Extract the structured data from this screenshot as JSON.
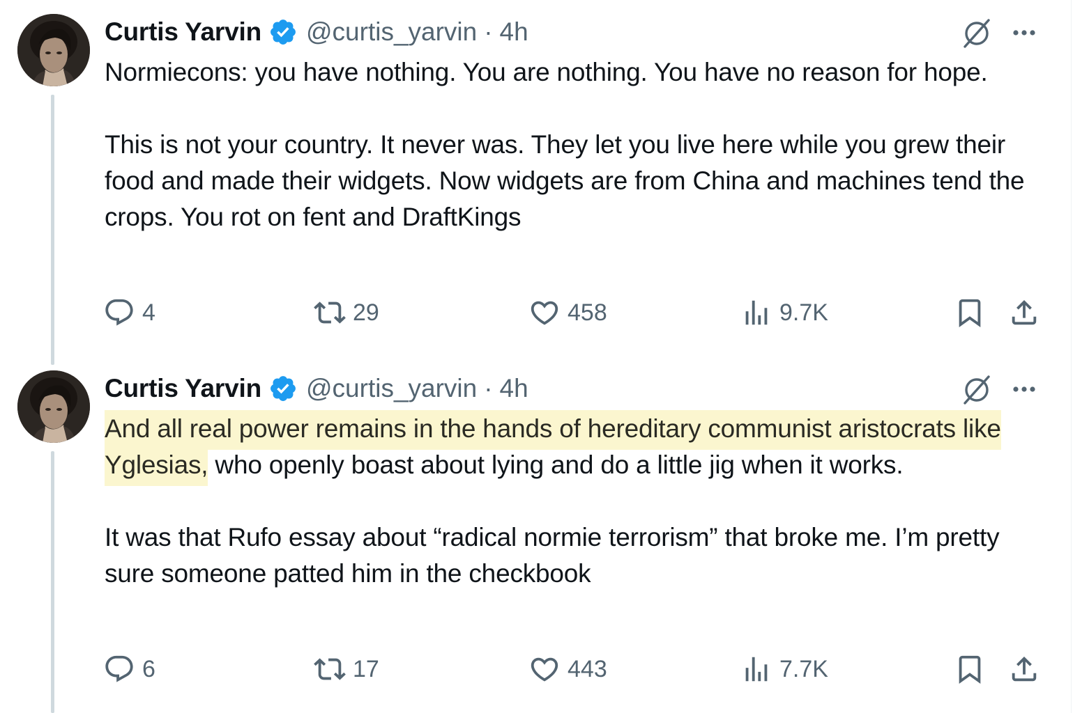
{
  "tweets": [
    {
      "author": {
        "name": "Curtis Yarvin",
        "handle": "@curtis_yarvin",
        "time": "4h",
        "separator": "·"
      },
      "text": {
        "p1": "Normiecons: you have nothing. You are nothing. You have no reason for hope.",
        "p2": "This is not your country. It never was. They let you live here while you grew their food and made their widgets. Now widgets are from China and machines tend the crops. You rot on fent and DraftKings"
      },
      "stats": {
        "replies": "4",
        "reposts": "29",
        "likes": "458",
        "views": "9.7K"
      }
    },
    {
      "author": {
        "name": "Curtis Yarvin",
        "handle": "@curtis_yarvin",
        "time": "4h",
        "separator": "·"
      },
      "text": {
        "highlighted": "And all real power remains in the hands of hereditary communist aristocrats like Yglesias,",
        "rest": " who openly boast about lying and do a little jig when it works.",
        "p2": "It was that Rufo essay about “radical normie terrorism” that broke me. I’m pretty sure someone patted him in the checkbook"
      },
      "stats": {
        "replies": "6",
        "reposts": "17",
        "likes": "443",
        "views": "7.7K"
      }
    }
  ],
  "icons": {
    "verified": "verified-badge-icon",
    "grok": "grok-icon",
    "more": "more-icon",
    "reply": "reply-icon",
    "repost": "repost-icon",
    "like": "heart-icon",
    "views": "views-icon",
    "bookmark": "bookmark-icon",
    "share": "share-icon"
  },
  "colors": {
    "text": "#0f1419",
    "secondary": "#536471",
    "verified": "#1d9bf0",
    "highlight": "#fbf6cf",
    "thread_line": "#cfd9de"
  }
}
